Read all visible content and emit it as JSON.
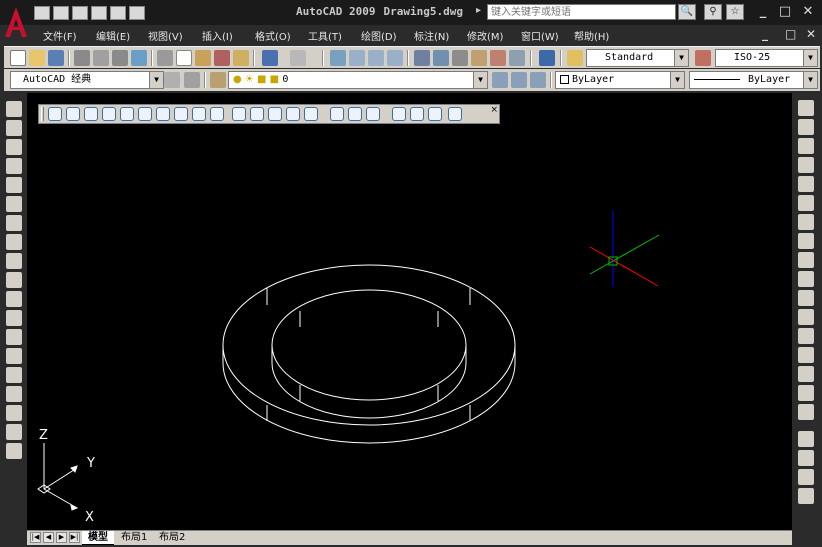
{
  "app": {
    "title_product": "AutoCAD 2009",
    "title_file": "Drawing5.dwg",
    "help_search_placeholder": "键入关键字或短语",
    "window_controls": [
      "_",
      "□",
      "✕"
    ],
    "doc_controls": [
      "_",
      "□",
      "✕"
    ]
  },
  "menus": [
    "文件(F)",
    "编辑(E)",
    "视图(V)",
    "插入(I)",
    "格式(O)",
    "工具(T)",
    "绘图(D)",
    "标注(N)",
    "修改(M)",
    "窗口(W)",
    "帮助(H)"
  ],
  "toolbar": {
    "text_style": "Standard",
    "dim_style": "ISO-25",
    "workspace": "AutoCAD 经典",
    "layer": "0",
    "color": "ByLayer",
    "linetype": "ByLayer"
  },
  "viewport": {
    "ucs_labels": {
      "z": "Z",
      "y": "Y",
      "x": "X"
    }
  },
  "tabs": [
    "模型",
    "布局1",
    "布局2"
  ],
  "colors": {
    "background": "#000000",
    "drawing_lines": "#ffffff",
    "cursor_green": "#00c000",
    "cursor_red": "#ff0000",
    "cursor_blue": "#0000ff",
    "ui_gray": "#d4d0c8",
    "logo_red": "#c8102e"
  }
}
